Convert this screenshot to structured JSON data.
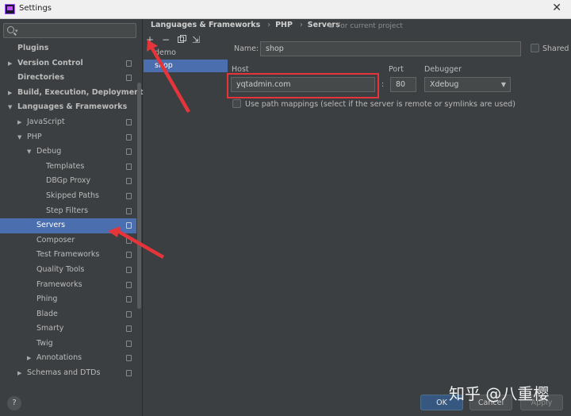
{
  "window": {
    "title": "Settings"
  },
  "sidebar": {
    "search_placeholder": "",
    "items": [
      {
        "label": "Plugins"
      },
      {
        "label": "Version Control"
      },
      {
        "label": "Directories"
      },
      {
        "label": "Build, Execution, Deployment"
      },
      {
        "label": "Languages & Frameworks"
      },
      {
        "label": "JavaScript"
      },
      {
        "label": "PHP"
      },
      {
        "label": "Debug"
      },
      {
        "label": "Templates"
      },
      {
        "label": "DBGp Proxy"
      },
      {
        "label": "Skipped Paths"
      },
      {
        "label": "Step Filters"
      },
      {
        "label": "Servers"
      },
      {
        "label": "Composer"
      },
      {
        "label": "Test Frameworks"
      },
      {
        "label": "Quality Tools"
      },
      {
        "label": "Frameworks"
      },
      {
        "label": "Phing"
      },
      {
        "label": "Blade"
      },
      {
        "label": "Smarty"
      },
      {
        "label": "Twig"
      },
      {
        "label": "Annotations"
      },
      {
        "label": "Schemas and DTDs"
      }
    ]
  },
  "breadcrumb": {
    "items": [
      "Languages & Frameworks",
      "PHP",
      "Servers"
    ],
    "scope": "For current project"
  },
  "servers": {
    "items": [
      "demo",
      "shop"
    ],
    "selected": "shop"
  },
  "form": {
    "name_label": "Name:",
    "name_value": "shop",
    "shared_label": "Shared",
    "host_label": "Host",
    "host_value": "yqtadmin.com",
    "port_label": "Port",
    "port_value": "80",
    "colon": ":",
    "debugger_label": "Debugger",
    "debugger_value": "Xdebug",
    "path_mappings_label": "Use path mappings (select if the server is remote or symlinks are used)"
  },
  "buttons": {
    "ok": "OK",
    "cancel": "Cancel",
    "apply": "Apply",
    "help": "?"
  },
  "watermark": "知乎 @八重樱",
  "colors": {
    "accent": "#4b6eaf",
    "annotation": "#e5353a"
  }
}
